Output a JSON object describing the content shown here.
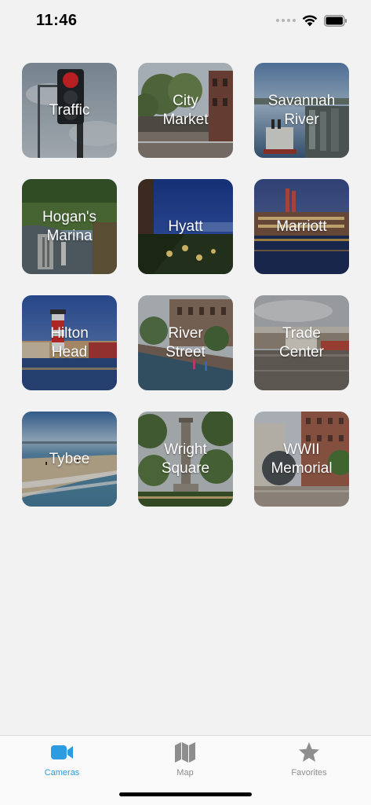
{
  "status_bar": {
    "time": "11:46",
    "icons": [
      "signal-dots-icon",
      "wifi-icon",
      "battery-icon"
    ]
  },
  "cameras": [
    {
      "label": "Traffic",
      "icon": "traffic-light-photo"
    },
    {
      "label": "City\nMarket",
      "icon": "city-market-photo"
    },
    {
      "label": "Savannah\nRiver",
      "icon": "savannah-river-photo"
    },
    {
      "label": "Hogan's\nMarina",
      "icon": "marina-photo"
    },
    {
      "label": "Hyatt",
      "icon": "hyatt-photo"
    },
    {
      "label": "Marriott",
      "icon": "marriott-photo"
    },
    {
      "label": "Hilton\nHead",
      "icon": "lighthouse-photo"
    },
    {
      "label": "River\nStreet",
      "icon": "river-street-photo"
    },
    {
      "label": "Trade\nCenter",
      "icon": "trade-center-photo"
    },
    {
      "label": "Tybee",
      "icon": "beach-photo"
    },
    {
      "label": "Wright\nSquare",
      "icon": "wright-square-photo"
    },
    {
      "label": "WWII\nMemorial",
      "icon": "memorial-photo"
    }
  ],
  "tab_bar": {
    "tabs": [
      {
        "label": "Cameras",
        "icon": "video-camera-icon",
        "active": true
      },
      {
        "label": "Map",
        "icon": "map-icon",
        "active": false
      },
      {
        "label": "Favorites",
        "icon": "star-icon",
        "active": false
      }
    ]
  },
  "colors": {
    "accent": "#2d9be0",
    "inactive": "#8e8e8e",
    "background": "#f2f2f2"
  }
}
